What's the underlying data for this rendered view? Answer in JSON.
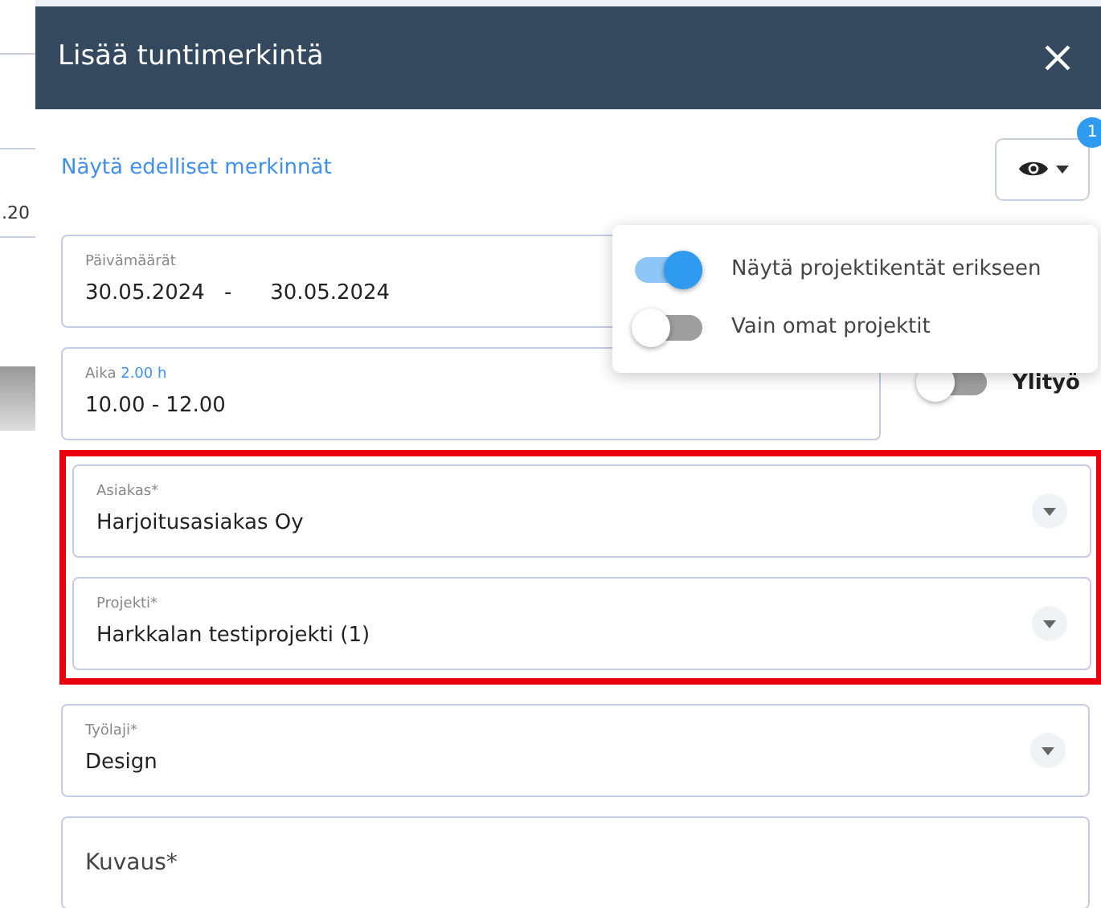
{
  "background": {
    "fragment": ".20"
  },
  "modal": {
    "title": "Lisää tuntimerkintä",
    "link": "Näytä edelliset merkinnät",
    "view_badge": "1",
    "date_field": {
      "label": "Päivämäärät",
      "start": "30.05.2024",
      "separator": "-",
      "end": "30.05.2024"
    },
    "time_field": {
      "label": "Aika",
      "duration": "2.00 h",
      "value": "10.00 - 12.00"
    },
    "overtime": {
      "label": "Ylityö",
      "on": false
    },
    "fields": [
      {
        "kind": "select",
        "label": "Asiakas*",
        "value": "Harjoitusasiakas Oy",
        "highlighted": true
      },
      {
        "kind": "select",
        "label": "Projekti*",
        "value": "Harkkalan testiprojekti (1)",
        "highlighted": true
      },
      {
        "kind": "select",
        "label": "Työlaji*",
        "value": "Design",
        "highlighted": false
      },
      {
        "kind": "textarea",
        "placeholder": "Kuvaus*",
        "highlighted": false
      }
    ],
    "view_menu": {
      "options": [
        {
          "label": "Näytä projektikentät erikseen",
          "on": true
        },
        {
          "label": "Vain omat projektit",
          "on": false
        }
      ]
    }
  }
}
